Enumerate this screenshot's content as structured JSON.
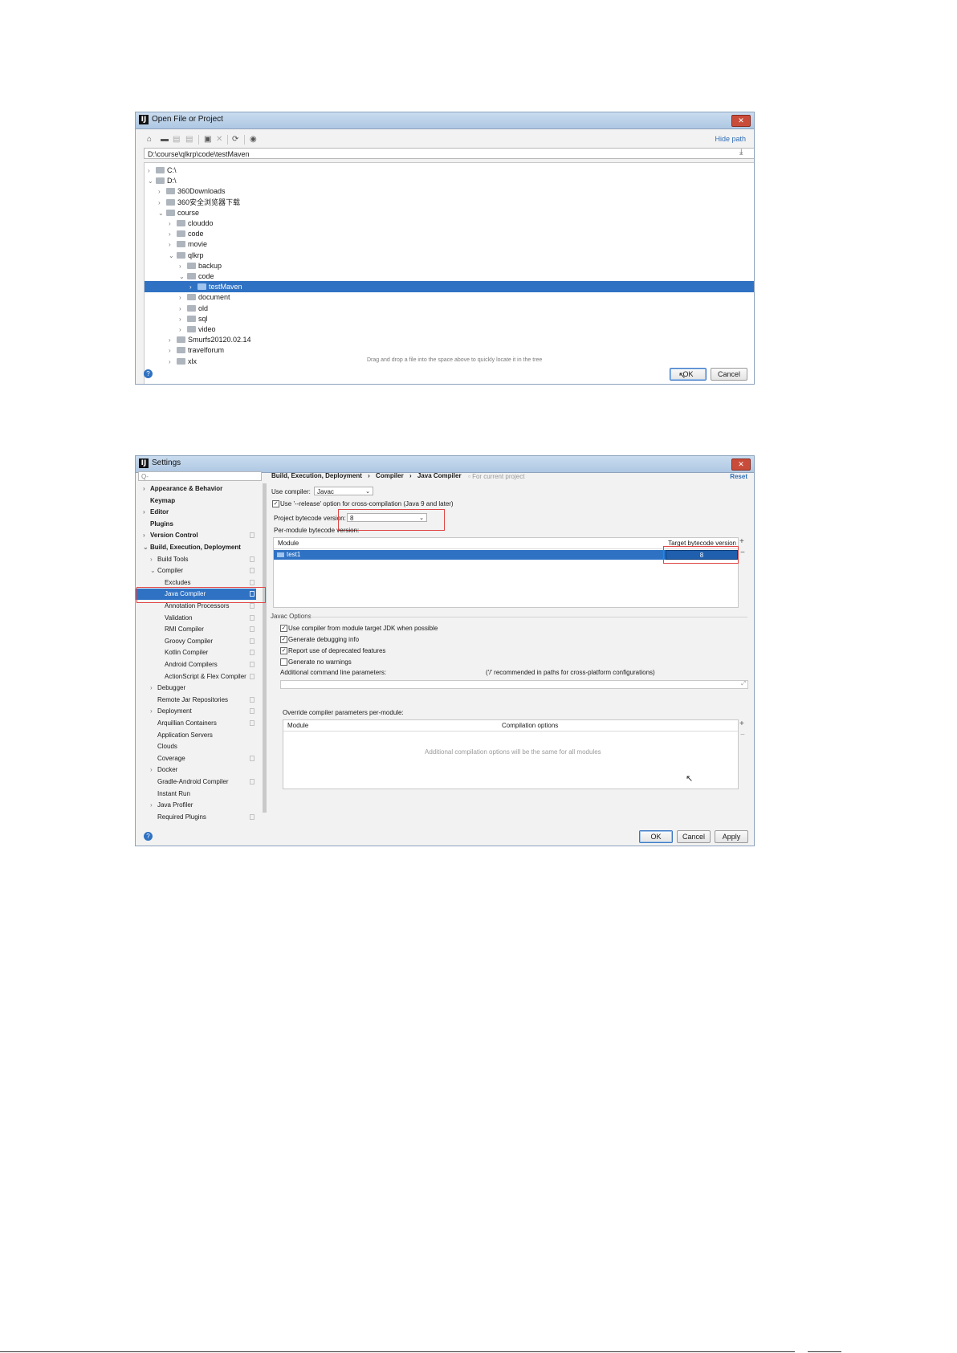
{
  "open_dialog": {
    "title": "Open File or Project",
    "hide_path": "Hide path",
    "path": "D:\\course\\qlkrp\\code\\testMaven",
    "tree": [
      {
        "label": "C:\\",
        "depth": 0,
        "chevron": ">"
      },
      {
        "label": "D:\\",
        "depth": 0,
        "chevron": "v"
      },
      {
        "label": "360Downloads",
        "depth": 1,
        "chevron": ">"
      },
      {
        "label": "360安全浏览器下载",
        "depth": 1,
        "chevron": ">"
      },
      {
        "label": "course",
        "depth": 1,
        "chevron": "v"
      },
      {
        "label": "clouddo",
        "depth": 2,
        "chevron": ">"
      },
      {
        "label": "code",
        "depth": 2,
        "chevron": ">"
      },
      {
        "label": "movie",
        "depth": 2,
        "chevron": ">"
      },
      {
        "label": "qlkrp",
        "depth": 2,
        "chevron": "v"
      },
      {
        "label": "backup",
        "depth": 3,
        "chevron": ">"
      },
      {
        "label": "code",
        "depth": 3,
        "chevron": "v"
      },
      {
        "label": "testMaven",
        "depth": 4,
        "chevron": ">",
        "selected": true
      },
      {
        "label": "document",
        "depth": 3,
        "chevron": ">"
      },
      {
        "label": "old",
        "depth": 3,
        "chevron": ">"
      },
      {
        "label": "sql",
        "depth": 3,
        "chevron": ">"
      },
      {
        "label": "video",
        "depth": 3,
        "chevron": ">"
      },
      {
        "label": "Smurfs20120.02.14",
        "depth": 2,
        "chevron": ">"
      },
      {
        "label": "travelforum",
        "depth": 2,
        "chevron": ">"
      },
      {
        "label": "xlx",
        "depth": 2,
        "chevron": ">"
      }
    ],
    "drag_hint": "Drag and drop a file into the space above to quickly locate it in the tree",
    "help": "?",
    "ok_label": "OK",
    "cancel_label": "Cancel"
  },
  "settings_dialog": {
    "title": "Settings",
    "search_placeholder": "Q-",
    "nav": [
      {
        "label": "Appearance & Behavior",
        "depth": 0,
        "bold": true,
        "chevron": ">"
      },
      {
        "label": "Keymap",
        "depth": 0,
        "bold": true
      },
      {
        "label": "Editor",
        "depth": 0,
        "bold": true,
        "chevron": ">"
      },
      {
        "label": "Plugins",
        "depth": 0,
        "bold": true
      },
      {
        "label": "Version Control",
        "depth": 0,
        "bold": true,
        "chevron": ">",
        "badge": true
      },
      {
        "label": "Build, Execution, Deployment",
        "depth": 0,
        "bold": true,
        "chevron": "v"
      },
      {
        "label": "Build Tools",
        "depth": 1,
        "chevron": ">",
        "badge": true
      },
      {
        "label": "Compiler",
        "depth": 1,
        "chevron": "v",
        "badge": true
      },
      {
        "label": "Excludes",
        "depth": 2,
        "badge": true
      },
      {
        "label": "Java Compiler",
        "depth": 2,
        "badge": true,
        "selected": true
      },
      {
        "label": "Annotation Processors",
        "depth": 2,
        "badge": true
      },
      {
        "label": "Validation",
        "depth": 2,
        "badge": true
      },
      {
        "label": "RMI Compiler",
        "depth": 2,
        "badge": true
      },
      {
        "label": "Groovy Compiler",
        "depth": 2,
        "badge": true
      },
      {
        "label": "Kotlin Compiler",
        "depth": 2,
        "badge": true
      },
      {
        "label": "Android Compilers",
        "depth": 2,
        "badge": true
      },
      {
        "label": "ActionScript & Flex Compiler",
        "depth": 2,
        "badge": true
      },
      {
        "label": "Debugger",
        "depth": 1,
        "chevron": ">"
      },
      {
        "label": "Remote Jar Repositories",
        "depth": 1,
        "badge": true
      },
      {
        "label": "Deployment",
        "depth": 1,
        "chevron": ">",
        "badge": true
      },
      {
        "label": "Arquillian Containers",
        "depth": 1,
        "badge": true
      },
      {
        "label": "Application Servers",
        "depth": 1
      },
      {
        "label": "Clouds",
        "depth": 1
      },
      {
        "label": "Coverage",
        "depth": 1,
        "badge": true
      },
      {
        "label": "Docker",
        "depth": 1,
        "chevron": ">"
      },
      {
        "label": "Gradle-Android Compiler",
        "depth": 1,
        "badge": true
      },
      {
        "label": "Instant Run",
        "depth": 1
      },
      {
        "label": "Java Profiler",
        "depth": 1,
        "chevron": ">"
      },
      {
        "label": "Required Plugins",
        "depth": 1,
        "badge": true
      }
    ],
    "breadcrumb": [
      "Build, Execution, Deployment",
      "Compiler",
      "Java Compiler"
    ],
    "for_current_project": "For current project",
    "reset": "Reset",
    "use_compiler_label": "Use compiler:",
    "use_compiler_value": "Javac",
    "release_option_label": "Use '--release' option for cross-compilation (Java 9 and later)",
    "project_bytecode_label": "Project bytecode version:",
    "project_bytecode_value": "8",
    "per_module_label": "Per-module bytecode version:",
    "module_table": {
      "headers": [
        "Module",
        "Target bytecode version"
      ],
      "rows": [
        {
          "module": "test1",
          "target": "8"
        }
      ]
    },
    "javac_options_label": "Javac Options",
    "javac_checkboxes": [
      {
        "label": "Use compiler from module target JDK when possible",
        "checked": true
      },
      {
        "label": "Generate debugging info",
        "checked": true
      },
      {
        "label": "Report use of deprecated features",
        "checked": true
      },
      {
        "label": "Generate no warnings",
        "checked": false
      }
    ],
    "additional_params_label": "Additional command line parameters:",
    "additional_params_hint": "('/' recommended in paths for cross-platform configurations)",
    "override_label": "Override compiler parameters per-module:",
    "override_table": {
      "headers": [
        "Module",
        "Compilation options"
      ],
      "empty_text": "Additional compilation options will be the same for all modules"
    },
    "help": "?",
    "ok_label": "OK",
    "cancel_label": "Cancel",
    "apply_label": "Apply"
  }
}
